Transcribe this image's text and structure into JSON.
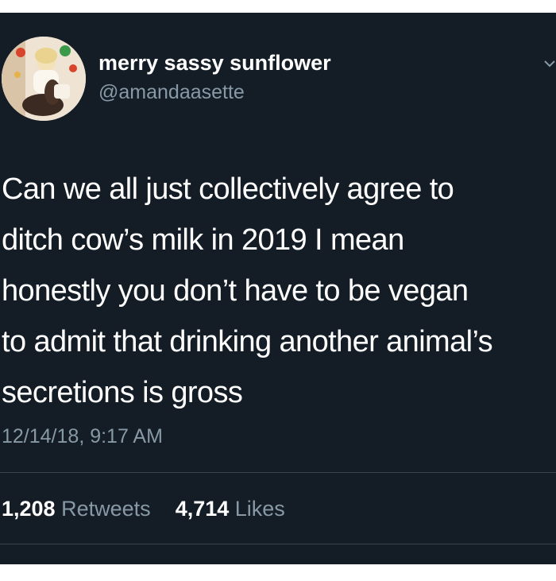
{
  "tweet": {
    "display_name": "merry sassy sunflower",
    "handle": "@amandaasette",
    "text": "Can we all just collectively agree to\nditch cow’s milk in 2019 I mean\nhonestly you don’t have to be vegan\nto admit that drinking another animal’s\nsecretions is gross",
    "timestamp": "12/14/18, 9:17 AM",
    "retweets_count": "1,208",
    "retweets_label": "Retweets",
    "likes_count": "4,714",
    "likes_label": "Likes"
  },
  "icons": {
    "avatar": "profile-photo",
    "menu": "chevron-down-icon"
  },
  "colors": {
    "background": "#141d26",
    "primary_text": "#ffffff",
    "secondary_text": "#8899a6",
    "divider": "#38444d"
  }
}
